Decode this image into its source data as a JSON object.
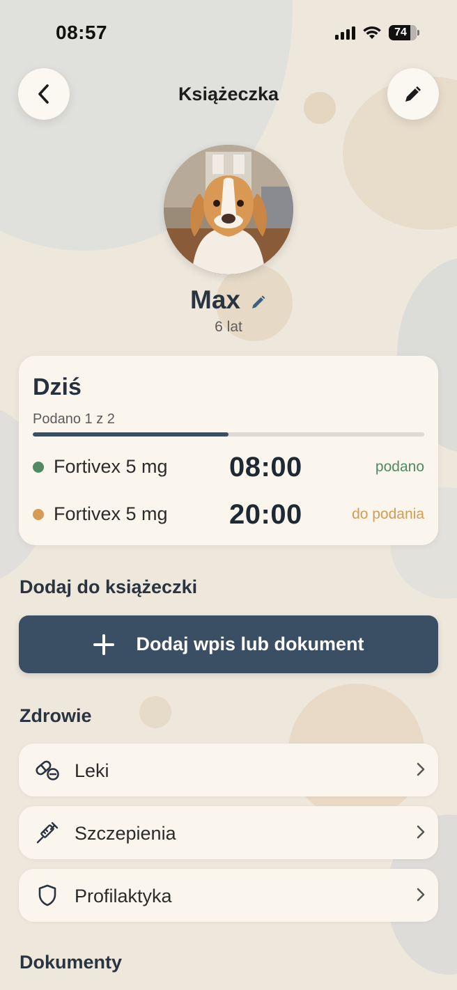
{
  "status_bar": {
    "time": "08:57",
    "battery": "74"
  },
  "nav": {
    "title": "Książeczka",
    "back_icon": "chevron-left-icon",
    "edit_icon": "pencil-icon"
  },
  "pet": {
    "name": "Max",
    "age": "6 lat",
    "photo": "dog-photo"
  },
  "today": {
    "title": "Dziś",
    "progress_label": "Podano 1 z 2",
    "progress": 0.5,
    "doses": [
      {
        "name": "Fortivex 5 mg",
        "time": "08:00",
        "status": "podano",
        "color": "#4f8a62"
      },
      {
        "name": "Fortivex 5 mg",
        "time": "20:00",
        "status": "do podania",
        "color": "#d69a55"
      }
    ]
  },
  "add_section": {
    "title": "Dodaj do książeczki",
    "button_label": "Dodaj wpis lub dokument"
  },
  "health": {
    "title": "Zdrowie",
    "items": [
      {
        "label": "Leki",
        "icon": "pills-icon"
      },
      {
        "label": "Szczepienia",
        "icon": "syringe-icon"
      },
      {
        "label": "Profilaktyka",
        "icon": "shield-icon"
      }
    ]
  },
  "documents": {
    "title": "Dokumenty"
  },
  "colors": {
    "accent": "#3a4f63",
    "background": "#ede7dc",
    "card": "#faf6ee"
  }
}
